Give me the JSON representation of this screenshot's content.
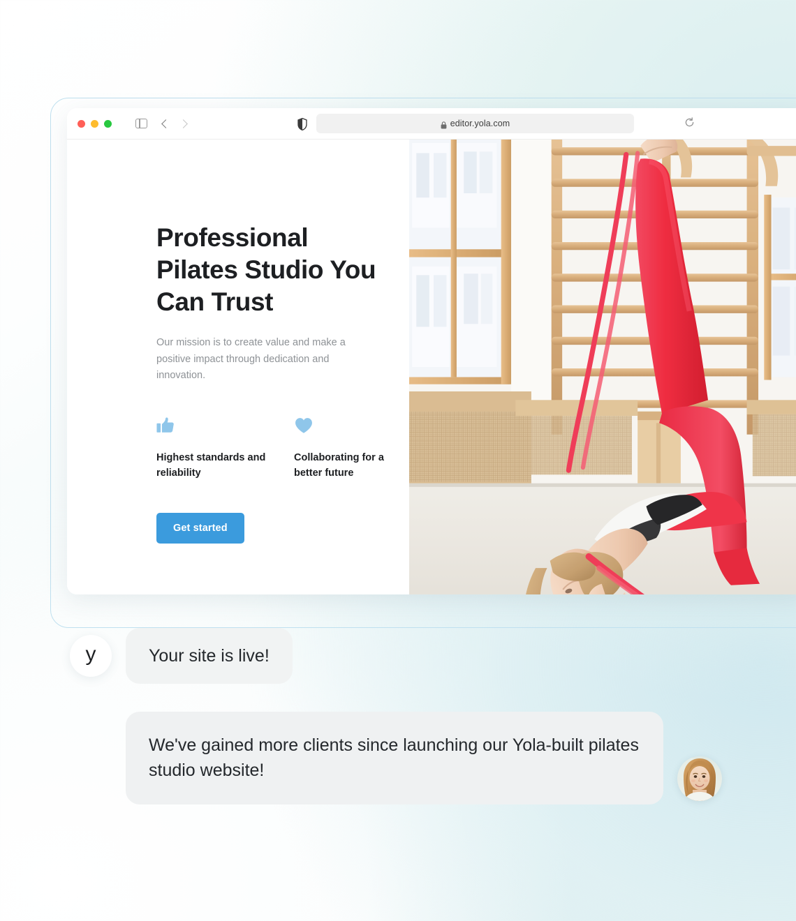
{
  "browser": {
    "url": "editor.yola.com",
    "icons": {
      "traffic_close": "close-window-dot",
      "traffic_minimize": "minimize-window-dot",
      "traffic_zoom": "zoom-window-dot",
      "sidebar": "sidebar-toggle-icon",
      "back": "back-arrow-icon",
      "forward": "forward-arrow-icon",
      "shield": "shield-privacy-icon",
      "lock": "lock-icon",
      "reload": "reload-icon"
    }
  },
  "hero": {
    "title": "Professional Pilates Studio You Can Trust",
    "subtitle": "Our mission is to create value and make a positive impact through dedication and innovation.",
    "features": [
      {
        "icon": "thumbs-up-icon",
        "label": "Highest standards and reliability"
      },
      {
        "icon": "heart-icon",
        "label": "Collaborating for a better future"
      }
    ],
    "cta_label": "Get started",
    "photo_alt": "woman in red leggings doing a pilates stretch with a resistance band at wooden wall bars"
  },
  "chat": {
    "brand_initial": "y",
    "messages": [
      {
        "text": "Your site is live!"
      },
      {
        "text": "We've gained more clients since launching our Yola-built pilates studio website!"
      }
    ],
    "customer_avatar_alt": "smiling woman portrait"
  },
  "colors": {
    "accent": "#3b9bdd",
    "feature_icon": "#8fc6ea",
    "bubble": "#f1f3f3",
    "heading": "#1d1f22",
    "body_text": "#8e9296"
  }
}
